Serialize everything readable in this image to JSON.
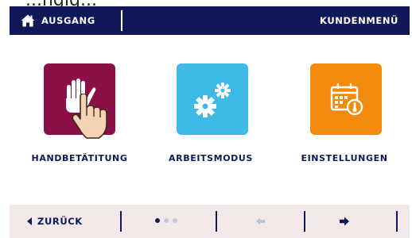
{
  "header": {
    "top_cut_text": "...ngig...",
    "home_label": "AUSGANG",
    "menu_label": "KUNDENMENÜ"
  },
  "tiles": [
    {
      "label": "HANDBETÄTITUNG",
      "icon": "hand-touch-icon",
      "color": "#8a1047"
    },
    {
      "label": "ARBEITSMODUS",
      "icon": "gears-icon",
      "color": "#3fb9e6"
    },
    {
      "label": "EINSTELLUNGEN",
      "icon": "calendar-thermometer-icon",
      "color": "#f28a0e"
    }
  ],
  "footer": {
    "back_label": "ZURÜCK",
    "page_indicator": {
      "pages": 3,
      "current": 1
    },
    "prev_icon": "arrow-left-icon",
    "next_icon": "arrow-right-icon"
  },
  "colors": {
    "navy": "#10185a",
    "footer_bg": "#f3e8e8",
    "inactive_arrow": "#b8c0dc"
  }
}
